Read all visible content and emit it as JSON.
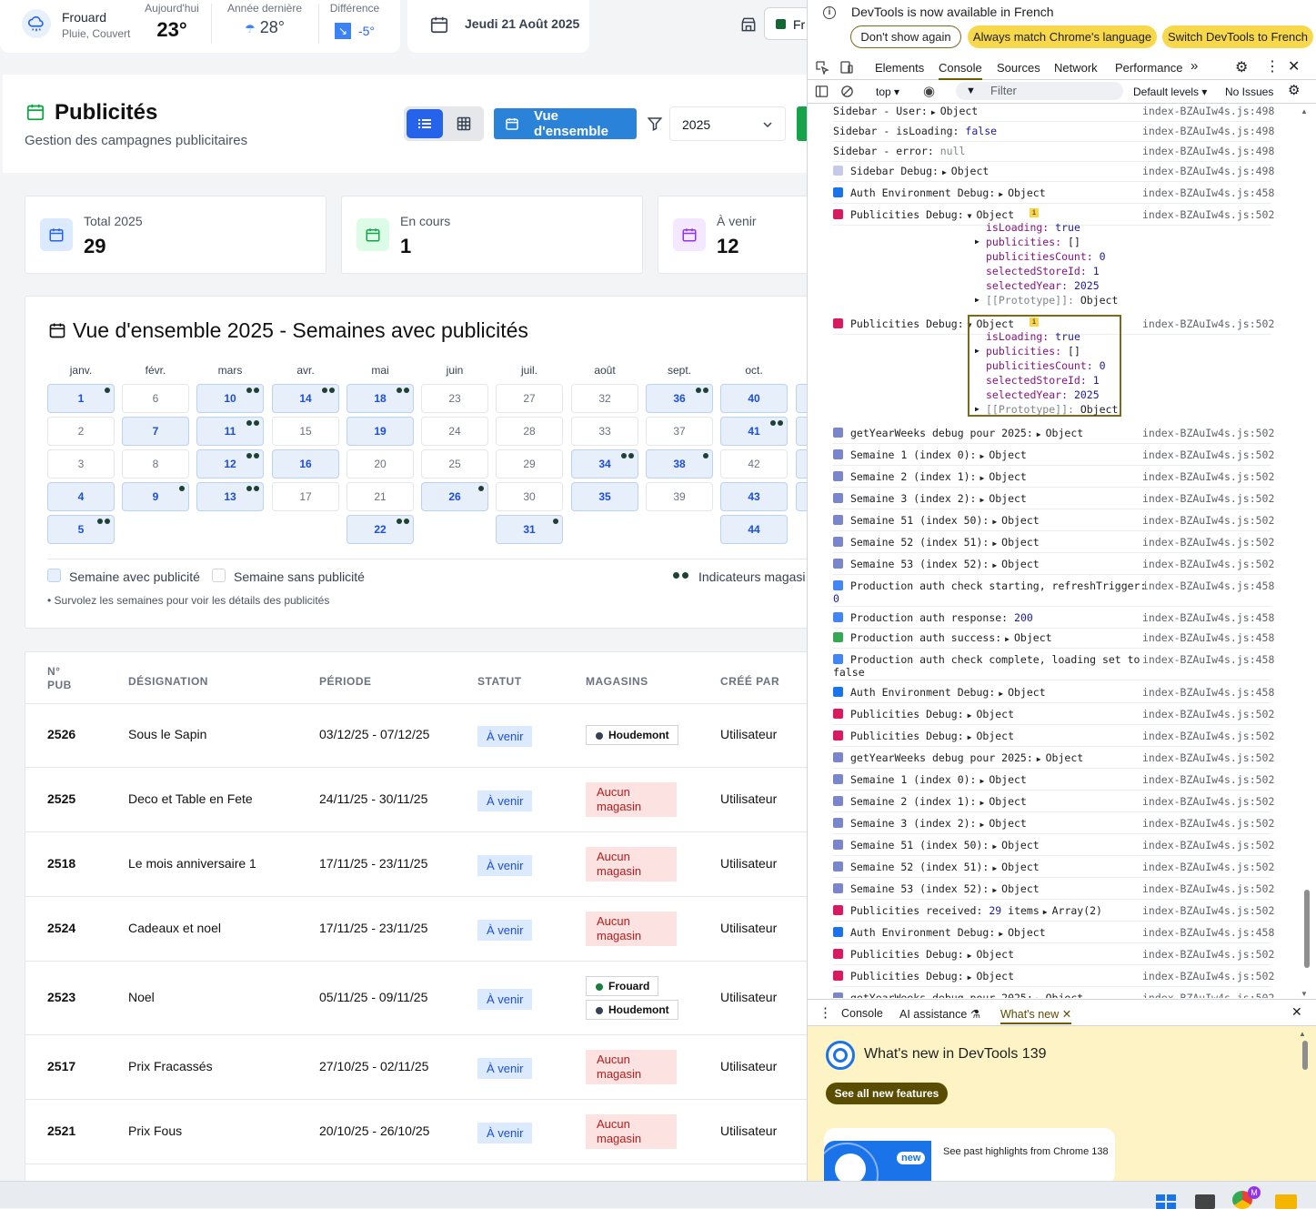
{
  "weather": {
    "city": "Frouard",
    "condition": "Pluie, Couvert",
    "today_label": "Aujourd'hui",
    "today_value": "23°",
    "last_year_label": "Année dernière",
    "last_year_value": "28°",
    "diff_label": "Différence",
    "diff_value": "-5°"
  },
  "date": "Jeudi 21 Août 2025",
  "store_selector": "Fr",
  "header": {
    "title": "Publicités",
    "subtitle": "Gestion des campagnes publicitaires",
    "overview_button": "Vue d'ensemble",
    "year": "2025"
  },
  "stats": [
    {
      "label": "Total 2025",
      "value": "29"
    },
    {
      "label": "En cours",
      "value": "1"
    },
    {
      "label": "À venir",
      "value": "12"
    }
  ],
  "overview": {
    "title": "Vue d'ensemble 2025 - Semaines avec publicités",
    "months": [
      "janv.",
      "févr.",
      "mars",
      "avr.",
      "mai",
      "juin",
      "juil.",
      "août",
      "sept.",
      "oct."
    ],
    "columns": [
      [
        {
          "w": "1",
          "on": true,
          "d": 1
        },
        {
          "w": "2",
          "on": false,
          "d": 0
        },
        {
          "w": "3",
          "on": false,
          "d": 0
        },
        {
          "w": "4",
          "on": true,
          "d": 0
        },
        {
          "w": "5",
          "on": true,
          "d": 2
        }
      ],
      [
        {
          "w": "6",
          "on": false,
          "d": 0
        },
        {
          "w": "7",
          "on": true,
          "d": 0
        },
        {
          "w": "8",
          "on": false,
          "d": 0
        },
        {
          "w": "9",
          "on": true,
          "d": 1
        }
      ],
      [
        {
          "w": "10",
          "on": true,
          "d": 2
        },
        {
          "w": "11",
          "on": true,
          "d": 2
        },
        {
          "w": "12",
          "on": true,
          "d": 2
        },
        {
          "w": "13",
          "on": true,
          "d": 2
        }
      ],
      [
        {
          "w": "14",
          "on": true,
          "d": 2
        },
        {
          "w": "15",
          "on": false,
          "d": 0
        },
        {
          "w": "16",
          "on": true,
          "d": 0
        },
        {
          "w": "17",
          "on": false,
          "d": 0
        }
      ],
      [
        {
          "w": "18",
          "on": true,
          "d": 2
        },
        {
          "w": "19",
          "on": true,
          "d": 0
        },
        {
          "w": "20",
          "on": false,
          "d": 0
        },
        {
          "w": "21",
          "on": false,
          "d": 0
        },
        {
          "w": "22",
          "on": true,
          "d": 2
        }
      ],
      [
        {
          "w": "23",
          "on": false,
          "d": 0
        },
        {
          "w": "24",
          "on": false,
          "d": 0
        },
        {
          "w": "25",
          "on": false,
          "d": 0
        },
        {
          "w": "26",
          "on": true,
          "d": 1
        }
      ],
      [
        {
          "w": "27",
          "on": false,
          "d": 0
        },
        {
          "w": "28",
          "on": false,
          "d": 0
        },
        {
          "w": "29",
          "on": false,
          "d": 0
        },
        {
          "w": "30",
          "on": false,
          "d": 0
        },
        {
          "w": "31",
          "on": true,
          "d": 1
        }
      ],
      [
        {
          "w": "32",
          "on": false,
          "d": 0
        },
        {
          "w": "33",
          "on": false,
          "d": 0
        },
        {
          "w": "34",
          "on": true,
          "d": 2
        },
        {
          "w": "35",
          "on": true,
          "d": 0
        }
      ],
      [
        {
          "w": "36",
          "on": true,
          "d": 2
        },
        {
          "w": "37",
          "on": false,
          "d": 0
        },
        {
          "w": "38",
          "on": true,
          "d": 1
        },
        {
          "w": "39",
          "on": false,
          "d": 0
        }
      ],
      [
        {
          "w": "40",
          "on": true,
          "d": 0
        },
        {
          "w": "41",
          "on": true,
          "d": 2
        },
        {
          "w": "42",
          "on": false,
          "d": 0
        },
        {
          "w": "43",
          "on": true,
          "d": 0
        },
        {
          "w": "44",
          "on": true,
          "d": 0
        }
      ]
    ],
    "legend_with": "Semaine avec publicité",
    "legend_without": "Semaine sans publicité",
    "legend_dots": "Indicateurs magasi",
    "hint": "• Survolez les semaines pour voir les détails des publicités"
  },
  "table": {
    "headers": {
      "num": "N° PUB",
      "designation": "DÉSIGNATION",
      "period": "PÉRIODE",
      "status": "STATUT",
      "stores": "MAGASINS",
      "created_by": "CRÉÉ PAR"
    },
    "rows": [
      {
        "num": "2526",
        "designation": "Sous le Sapin",
        "period": "03/12/25 - 07/12/25",
        "status": "À venir",
        "stores": [
          "Houdemont"
        ],
        "created_by": "Utilisateur"
      },
      {
        "num": "2525",
        "designation": "Deco et Table en Fete",
        "period": "24/11/25 - 30/11/25",
        "status": "À venir",
        "stores": [],
        "created_by": "Utilisateur"
      },
      {
        "num": "2518",
        "designation": "Le mois anniversaire 1",
        "period": "17/11/25 - 23/11/25",
        "status": "À venir",
        "stores": [],
        "created_by": "Utilisateur"
      },
      {
        "num": "2524",
        "designation": "Cadeaux et noel",
        "period": "17/11/25 - 23/11/25",
        "status": "À venir",
        "stores": [],
        "created_by": "Utilisateur"
      },
      {
        "num": "2523",
        "designation": "Noel",
        "period": "05/11/25 - 09/11/25",
        "status": "À venir",
        "stores": [
          "Frouard",
          "Houdemont"
        ],
        "created_by": "Utilisateur"
      },
      {
        "num": "2517",
        "designation": "Prix Fracassés",
        "period": "27/10/25 - 02/11/25",
        "status": "À venir",
        "stores": [],
        "created_by": "Utilisateur"
      },
      {
        "num": "2521",
        "designation": "Prix Fous",
        "period": "20/10/25 - 26/10/25",
        "status": "À venir",
        "stores": [],
        "created_by": "Utilisateur"
      }
    ],
    "no_store_label": "Aucun magasin"
  },
  "devtools": {
    "info_text": "DevTools is now available in French",
    "btn_dont_show": "Don't show again",
    "btn_match": "Always match Chrome's language",
    "btn_switch": "Switch DevTools to French",
    "tabs": [
      "Elements",
      "Console",
      "Sources",
      "Network",
      "Performance"
    ],
    "context": "top",
    "filter_placeholder": "Filter",
    "levels": "Default levels",
    "issues": "No Issues",
    "obj_props": {
      "isLoading": "true",
      "publicities": "[]",
      "publicitiesCount": "0",
      "selectedStoreId": "1",
      "selectedYear": "2025",
      "proto": "Object"
    },
    "drawer_tabs": [
      "Console",
      "AI assistance",
      "What's new"
    ],
    "whatsnew_title": "What's new in DevTools 139",
    "see_all": "See all new features",
    "highlight_badge": "new",
    "highlight_text": "See past highlights from Chrome 138"
  },
  "console_lines": [
    {
      "t": "Sidebar - User:",
      "o": "Object",
      "s": "index-BZAuIw4s.js:498",
      "ic": "none"
    },
    {
      "t": "Sidebar - isLoading:",
      "v": "false",
      "s": "index-BZAuIw4s.js:498",
      "ic": "none"
    },
    {
      "t": "Sidebar - error:",
      "v": "null",
      "s": "index-BZAuIw4s.js:498",
      "ic": "none"
    },
    {
      "t": "Sidebar Debug:",
      "o": "Object",
      "s": "index-BZAuIw4s.js:498",
      "ic": "pen"
    },
    {
      "t": "Auth Environment Debug:",
      "o": "Object",
      "s": "index-BZAuIw4s.js:458",
      "ic": "search"
    },
    {
      "t": "Publicities Debug:",
      "o": "Object",
      "s": "index-BZAuIw4s.js:502",
      "ic": "mega"
    },
    {
      "t": "Publicities Debug:",
      "o": "Object",
      "s": "index-BZAuIw4s.js:502",
      "ic": "mega"
    },
    {
      "t": "getYearWeeks debug pour 2025:",
      "o": "Object",
      "s": "index-BZAuIw4s.js:502",
      "ic": "cal"
    },
    {
      "t": "Semaine 1 (index 0):",
      "o": "Object",
      "s": "index-BZAuIw4s.js:502",
      "ic": "cal"
    },
    {
      "t": "Semaine 2 (index 1):",
      "o": "Object",
      "s": "index-BZAuIw4s.js:502",
      "ic": "cal"
    },
    {
      "t": "Semaine 3 (index 2):",
      "o": "Object",
      "s": "index-BZAuIw4s.js:502",
      "ic": "cal"
    },
    {
      "t": "Semaine 51 (index 50):",
      "o": "Object",
      "s": "index-BZAuIw4s.js:502",
      "ic": "cal"
    },
    {
      "t": "Semaine 52 (index 51):",
      "o": "Object",
      "s": "index-BZAuIw4s.js:502",
      "ic": "cal"
    },
    {
      "t": "Semaine 53 (index 52):",
      "o": "Object",
      "s": "index-BZAuIw4s.js:502",
      "ic": "cal"
    },
    {
      "t": "Production auth check starting, refreshTrigger:",
      "t2": "0",
      "s": "index-BZAuIw4s.js:458",
      "ic": "ref"
    },
    {
      "t": "Production auth response:",
      "v": "200",
      "s": "index-BZAuIw4s.js:458",
      "ic": "ref"
    },
    {
      "t": "Production auth success:",
      "o": "Object",
      "s": "index-BZAuIw4s.js:458",
      "ic": "ok"
    },
    {
      "t": "Production auth check complete, loading set to",
      "t2": "false",
      "s": "index-BZAuIw4s.js:458",
      "ic": "ref"
    },
    {
      "t": "Auth Environment Debug:",
      "o": "Object",
      "s": "index-BZAuIw4s.js:458",
      "ic": "search"
    },
    {
      "t": "Publicities Debug:",
      "o": "Object",
      "s": "index-BZAuIw4s.js:502",
      "ic": "mega"
    },
    {
      "t": "Publicities Debug:",
      "o": "Object",
      "s": "index-BZAuIw4s.js:502",
      "ic": "mega"
    },
    {
      "t": "getYearWeeks debug pour 2025:",
      "o": "Object",
      "s": "index-BZAuIw4s.js:502",
      "ic": "cal"
    },
    {
      "t": "Semaine 1 (index 0):",
      "o": "Object",
      "s": "index-BZAuIw4s.js:502",
      "ic": "cal"
    },
    {
      "t": "Semaine 2 (index 1):",
      "o": "Object",
      "s": "index-BZAuIw4s.js:502",
      "ic": "cal"
    },
    {
      "t": "Semaine 3 (index 2):",
      "o": "Object",
      "s": "index-BZAuIw4s.js:502",
      "ic": "cal"
    },
    {
      "t": "Semaine 51 (index 50):",
      "o": "Object",
      "s": "index-BZAuIw4s.js:502",
      "ic": "cal"
    },
    {
      "t": "Semaine 52 (index 51):",
      "o": "Object",
      "s": "index-BZAuIw4s.js:502",
      "ic": "cal"
    },
    {
      "t": "Semaine 53 (index 52):",
      "o": "Object",
      "s": "index-BZAuIw4s.js:502",
      "ic": "cal"
    },
    {
      "t": "Publicities received:",
      "v": "29",
      "t3": "items",
      "o": "Array(2)",
      "s": "index-BZAuIw4s.js:502",
      "ic": "mega"
    },
    {
      "t": "Auth Environment Debug:",
      "o": "Object",
      "s": "index-BZAuIw4s.js:458",
      "ic": "search"
    },
    {
      "t": "Publicities Debug:",
      "o": "Object",
      "s": "index-BZAuIw4s.js:502",
      "ic": "mega"
    },
    {
      "t": "Publicities Debug:",
      "o": "Object",
      "s": "index-BZAuIw4s.js:502",
      "ic": "mega"
    },
    {
      "t": "getYearWeeks debug pour 2025:",
      "o": "Object",
      "s": "index-BZAuIw4s.js:502",
      "ic": "cal"
    }
  ],
  "colors": {
    "accent": "#2b82d9",
    "dot": "#1e4035",
    "devtools_info": "#fdf3c5"
  }
}
